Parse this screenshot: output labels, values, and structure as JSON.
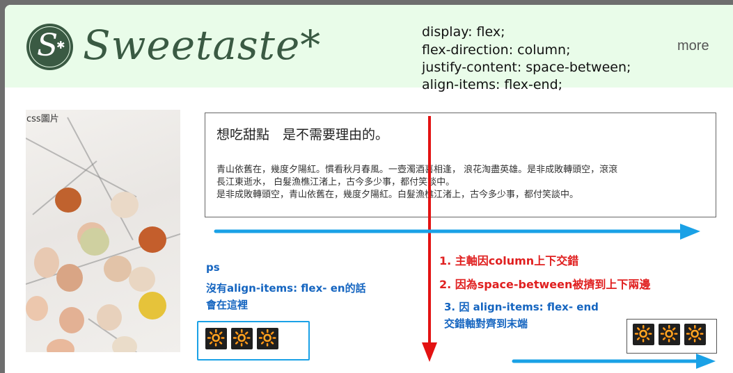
{
  "header": {
    "logo_letter": "S",
    "brand": "Sweetaste*",
    "more_link": "more"
  },
  "css_note": {
    "lines": [
      "display: flex;",
      "flex-direction: column;",
      "justify-content: space-between;",
      "align-items: flex-end;"
    ]
  },
  "image": {
    "label": "css圖片",
    "icon": "macaron-photo-icon"
  },
  "text_box": {
    "title": "想吃甜點　是不需要理由的。",
    "lines": [
      "青山依舊在，幾度夕陽紅。慣看秋月春風。一壺濁酒喜相逢， 浪花淘盡英雄。是非成敗轉頭空，滾滾",
      "長江東逝水， 白髮漁樵江渚上，古今多少事，都付笑談中。",
      "是非成敗轉頭空，青山依舊在，幾度夕陽紅。白髮漁樵江渚上，古今多少事，都付笑談中。"
    ]
  },
  "annotations": {
    "red": [
      "1. 主軸因column上下交錯",
      "2. 因為space-between被擠到上下兩邊"
    ],
    "blue_ps": [
      "ps",
      "沒有align-items: flex- en的話",
      "會在這裡"
    ],
    "blue_3": [
      "3. 因 align-items: flex- end",
      "交錯軸對齊到末端"
    ]
  },
  "icons": {
    "sun_icon": "sun-icon",
    "left_group": [
      "🔆",
      "🔆",
      "🔆"
    ],
    "right_group": [
      "🔆",
      "🔆",
      "🔆"
    ]
  },
  "colors": {
    "header_bg": "#e9fce9",
    "brand": "#3a5a43",
    "red_arrow": "#e31212",
    "blue_arrow": "#1aa1e6"
  }
}
